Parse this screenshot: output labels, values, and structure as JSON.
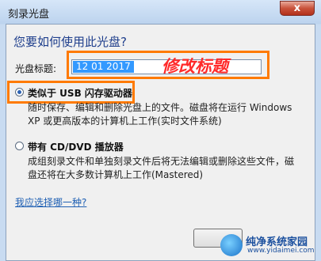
{
  "window": {
    "title": "刻录光盘",
    "close_glyph": "x"
  },
  "question": "您要如何使用此光盘?",
  "disc_title": {
    "label": "光盘标题:",
    "value": "12 01 2017"
  },
  "annotation": "修改标题",
  "options": [
    {
      "label": "类似于 USB 闪存驱动器",
      "selected": true,
      "description": [
        "随时保存、编辑和删除光盘上的文件。磁盘将在运行 Windows",
        "XP 或更高版本的计算机上工作(实时文件系统)"
      ]
    },
    {
      "label": "带有 CD/DVD 播放器",
      "selected": false,
      "description": [
        "成组刻录文件和单独刻录文件后将无法编辑或删除这些文件，磁",
        "盘还将在大多数计算机上工作(Mastered)"
      ]
    }
  ],
  "help_link": "我应选择哪一种?",
  "watermark": {
    "name": "纯净系统家园",
    "url": "www.yidaimei.com"
  },
  "colors": {
    "highlight": "#ff7a00",
    "annotation": "#ff2a2a",
    "link": "#1e5fb3"
  }
}
